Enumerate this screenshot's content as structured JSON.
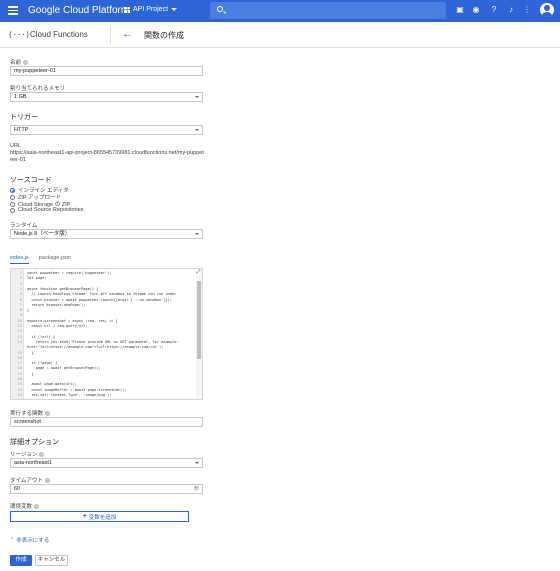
{
  "topbar": {
    "brand": "Google Cloud Platform",
    "project": "API Project",
    "icons": [
      "menu-icon",
      "search-icon",
      "cloud-shell-icon",
      "notifications-icon",
      "help-icon",
      "bell-icon",
      "more-icon",
      "avatar"
    ]
  },
  "subheader": {
    "logo": "(···)",
    "product": "Cloud Functions",
    "page_title": "関数の作成"
  },
  "form": {
    "name_label": "名前",
    "name_value": "my-puppeteer-01",
    "memory_label": "割り当てられるメモリ",
    "memory_value": "1 GB",
    "trigger_heading": "トリガー",
    "trigger_value": "HTTP",
    "url_label": "URL",
    "url_value": "https://asia-northeast1-api-project-865545739981.cloudfunctions.net/my-puppeteer-01",
    "source_heading": "ソースコード",
    "source_options": [
      {
        "label": "インライン エディタ",
        "checked": true
      },
      {
        "label": "ZIP アップロード",
        "checked": false
      },
      {
        "label": "Cloud Storage の ZIP",
        "checked": false
      },
      {
        "label": "Cloud Source Repositories",
        "checked": false
      }
    ],
    "runtime_label": "ランタイム",
    "runtime_value": "Node.js 8（ベータ版）",
    "tabs": [
      "index.js",
      "package.json"
    ],
    "code_lines": [
      "const puppeteer = require('puppeteer');",
      "let page;",
      "",
      "async function getBrowserPage() {",
      "  // Launch headless Chrome. Turn off sandbox so Chrome can run under",
      "  const browser = await puppeteer.launch({args: ['--no-sandbox']});",
      "  return browser.newPage();",
      "}",
      "",
      "exports.screenshot = async (req, res) => {",
      "  const url = req.query.url;",
      "",
      "  if (!url) {",
      "    return res.send('Please provide URL as GET parameter, for example:",
      "href=\"?url=https://example.com\">?url=https://example.com</a>');",
      "  }",
      "",
      "  if (!page) {",
      "    page = await getBrowserPage();",
      "  }",
      "",
      "  await page.goto(url);",
      "  const imageBuffer = await page.screenshot();",
      "  res.set('Content-Type', 'image/png');"
    ],
    "line_numbers": [
      "1",
      "2",
      "3",
      "4",
      "5",
      "6",
      "7",
      "8",
      "9",
      "10",
      "11",
      "12",
      "13",
      "14",
      "",
      "15",
      "16",
      "17",
      "18",
      "19",
      "20",
      "21",
      "22",
      "23"
    ],
    "function_label": "実行する関数",
    "function_value": "screenshot",
    "advanced_heading": "詳細オプション",
    "region_label": "リージョン",
    "region_value": "asia-northeast1",
    "timeout_label": "タイムアウト",
    "timeout_value": "60",
    "timeout_unit": "秒",
    "env_label": "環境変数",
    "add_variable": "変数を追加",
    "hide_link": "非表示にする",
    "create_button": "作成",
    "cancel_button": "キャンセル"
  },
  "colors": {
    "brand_blue": "#2d64d6",
    "text": "#212121"
  }
}
